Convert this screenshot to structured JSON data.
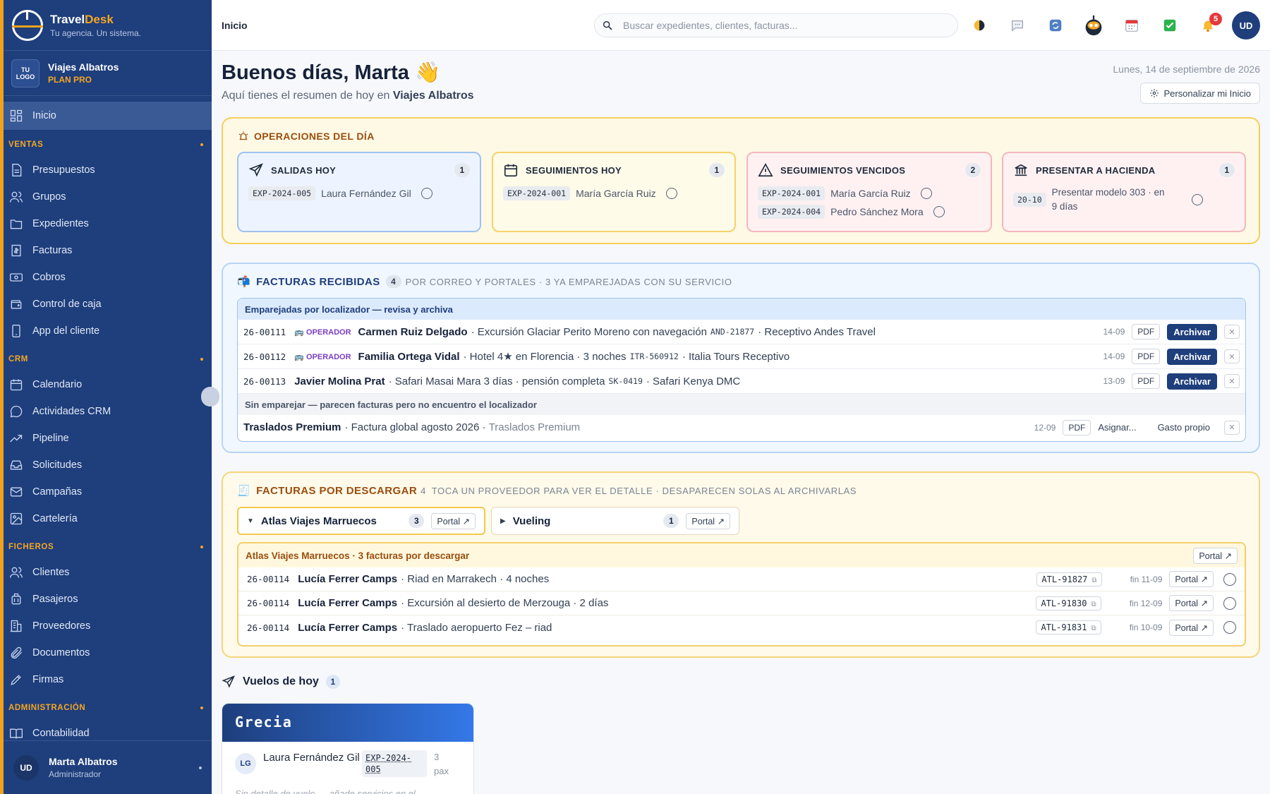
{
  "brand": {
    "name_a": "Travel",
    "name_b": "Desk",
    "tagline": "Tu agencia. Un sistema."
  },
  "agency": {
    "logo": "TU LOGO",
    "name": "Viajes Albatros",
    "plan": "PLAN PRO"
  },
  "nav": {
    "home": "Inicio",
    "sections": [
      {
        "title": "VENTAS",
        "items": [
          "Presupuestos",
          "Grupos",
          "Expedientes",
          "Facturas",
          "Cobros",
          "Control de caja",
          "App del cliente"
        ]
      },
      {
        "title": "CRM",
        "items": [
          "Calendario",
          "Actividades CRM",
          "Pipeline",
          "Solicitudes",
          "Campañas",
          "Cartelería"
        ]
      },
      {
        "title": "FICHEROS",
        "items": [
          "Clientes",
          "Pasajeros",
          "Proveedores",
          "Documentos",
          "Firmas"
        ]
      },
      {
        "title": "ADMINISTRACIÓN",
        "items": [
          "Contabilidad"
        ]
      }
    ]
  },
  "user": {
    "initials": "UD",
    "name": "Marta Albatros",
    "role": "Administrador"
  },
  "topbar": {
    "breadcrumb": "Inicio",
    "search_placeholder": "Buscar expedientes, clientes, facturas...",
    "notifications": "5",
    "avatar": "UD"
  },
  "header": {
    "greeting": "Buenos días, Marta 👋",
    "subtitle_prefix": "Aquí tienes el resumen de hoy en",
    "subtitle_agency": "Viajes Albatros",
    "date": "Lunes, 14 de septiembre de 2026",
    "customize": "Personalizar mi Inicio"
  },
  "operations": {
    "title": "OPERACIONES DEL DÍA",
    "cards": [
      {
        "title": "SALIDAS HOY",
        "count": "1",
        "rows": [
          {
            "code": "EXP-2024-005",
            "name": "Laura Fernández Gil"
          }
        ]
      },
      {
        "title": "SEGUIMIENTOS HOY",
        "count": "1",
        "rows": [
          {
            "code": "EXP-2024-001",
            "name": "María García Ruiz"
          }
        ]
      },
      {
        "title": "SEGUIMIENTOS VENCIDOS",
        "count": "2",
        "rows": [
          {
            "code": "EXP-2024-001",
            "name": "María García Ruiz"
          },
          {
            "code": "EXP-2024-004",
            "name": "Pedro Sánchez Mora"
          }
        ]
      },
      {
        "title": "PRESENTAR A HACIENDA",
        "count": "1",
        "rows": [
          {
            "code": "20-10",
            "name": "Presentar modelo 303 · en 9 días"
          }
        ]
      }
    ]
  },
  "received": {
    "title": "FACTURAS RECIBIDAS",
    "count": "4",
    "note": "POR CORREO Y PORTALES · 3 YA EMPAREJADAS CON SU SERVICIO",
    "matched_header": "Emparejadas por localizador — revisa y archiva",
    "unmatched_header": "Sin emparejar — parecen facturas pero no encuentro el localizador",
    "operator_tag": "OPERADOR",
    "pdf": "PDF",
    "archive": "Archivar",
    "assign": "Asignar...",
    "own_expense": "Gasto propio",
    "rows": [
      {
        "num": "26-00111",
        "client": "Carmen Ruiz Delgado",
        "desc": "· Excursión Glaciar Perito Moreno con navegación",
        "loc": "AND-21877",
        "prov": "· Receptivo Andes Travel",
        "date": "14-09"
      },
      {
        "num": "26-00112",
        "client": "Familia Ortega Vidal",
        "desc": "· Hotel 4★ en Florencia · 3 noches",
        "loc": "ITR-560912",
        "prov": "· Italia Tours Receptivo",
        "date": "14-09"
      },
      {
        "num": "26-00113",
        "client": "Javier Molina Prat",
        "desc": "· Safari Masai Mara 3 días · pensión completa",
        "loc": "SK-0419",
        "prov": "· Safari Kenya DMC",
        "date": "13-09"
      }
    ],
    "unmatched": {
      "client": "Traslados Premium",
      "desc": "· Factura global agosto 2026 ·",
      "prov": "Traslados Premium",
      "date": "12-09"
    }
  },
  "downloads": {
    "title": "FACTURAS POR DESCARGAR",
    "count": "4",
    "note": "TOCA UN PROVEEDOR PARA VER EL DETALLE · DESAPARECEN SOLAS AL ARCHIVARLAS",
    "portal": "Portal ↗",
    "providers": [
      {
        "name": "Atlas Viajes Marruecos",
        "count": "3",
        "caret": "▼"
      },
      {
        "name": "Vueling",
        "count": "1",
        "caret": "▶"
      }
    ],
    "detail_header": "Atlas Viajes Marruecos · 3 facturas por descargar",
    "rows": [
      {
        "num": "26-00114",
        "client": "Lucía Ferrer Camps",
        "desc": "· Riad en Marrakech · 4 noches",
        "ref": "ATL-91827",
        "fin": "fin 11-09"
      },
      {
        "num": "26-00114",
        "client": "Lucía Ferrer Camps",
        "desc": "· Excursión al desierto de Merzouga · 2 días",
        "ref": "ATL-91830",
        "fin": "fin 12-09"
      },
      {
        "num": "26-00114",
        "client": "Lucía Ferrer Camps",
        "desc": "· Traslado aeropuerto Fez – riad",
        "ref": "ATL-91831",
        "fin": "fin 10-09"
      }
    ]
  },
  "flights": {
    "title": "Vuelos de hoy",
    "count": "1",
    "card": {
      "destination": "Grecia",
      "initials": "LG",
      "name": "Laura Fernández Gil",
      "code": "EXP-2024-005",
      "pax": "3 pax",
      "note": "Sin detalle de vuelo — añade servicios en el"
    }
  },
  "colors": {
    "sidebar": "#1e3e7c",
    "accent": "#f5a623",
    "primary": "#1e3e7c",
    "danger": "#e5393b"
  }
}
